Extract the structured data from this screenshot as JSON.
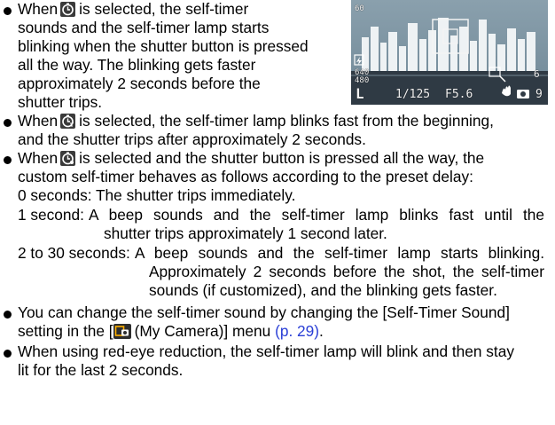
{
  "bullets": {
    "b1": {
      "l1_pre": "When",
      "icon1": "self-timer-10s-icon",
      "l1_post": "is selected, the self-timer",
      "l2": "sounds and the self-timer lamp starts",
      "l3": "blinking when the shutter button is pressed",
      "l4": "all the way. The blinking gets faster",
      "l5": "approximately 2 seconds before the",
      "l6": "shutter trips."
    },
    "b2": {
      "l1_pre": "When",
      "icon": "self-timer-2s-icon",
      "l1_post": "is selected, the self-timer lamp blinks fast from the beginning,",
      "l2": "and the shutter trips after approximately 2 seconds."
    },
    "b3": {
      "l1_pre": "When",
      "icon": "custom-timer-icon",
      "l1_post": "is selected and the shutter button is pressed all the way, the",
      "l2": "custom self-timer behaves as follows according to the preset delay:",
      "d0_label": "0 seconds:",
      "d0_text": "The shutter trips immediately.",
      "d1_label": "1 second:",
      "d1_text_a": "A beep sounds and the self-timer lamp blinks fast until the",
      "d1_text_b": "shutter trips approximately 1 second later.",
      "d2_label": "2 to 30 seconds:",
      "d2_text_a": "A beep sounds and the self-timer lamp starts blinking.",
      "d2_text_b": "Approximately 2 seconds before the shot, the self-timer",
      "d2_text_c": "sounds (if customized), and the blinking gets faster."
    },
    "b4": {
      "l1": "You can change the self-timer sound by changing the [Self-Timer Sound]",
      "l2_pre": "setting in the [",
      "icon": "my-camera-icon",
      "l2_mid": "(My Camera)] menu",
      "l2_link": "(p. 29)",
      "l2_end": "."
    },
    "b5": {
      "l1": "When using red-eye reduction, the self-timer lamp will blink and then stay",
      "l2": "lit for the last 2 seconds."
    }
  },
  "lcd": {
    "top_left": "60",
    "top_left_small": "6Q0",
    "res_a": "640",
    "res_b": "480",
    "shutter": "1/125",
    "aperture": "F5.6",
    "count_right": "6",
    "shots_left": "9",
    "mode_large": "L"
  }
}
